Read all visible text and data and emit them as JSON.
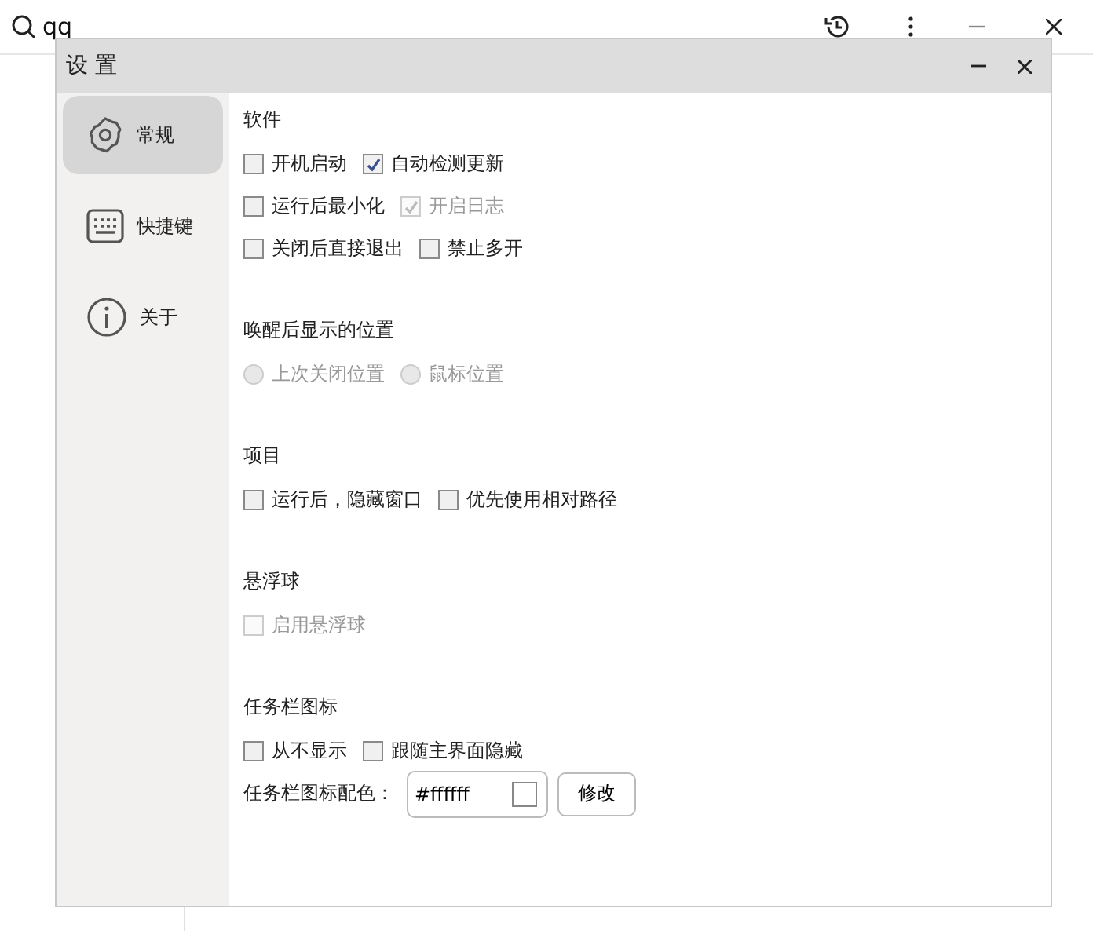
{
  "app_bar": {
    "search_value": "qq"
  },
  "window": {
    "title": "设 置"
  },
  "sidebar": {
    "items": [
      {
        "label": "常规",
        "selected": true
      },
      {
        "label": "快捷键",
        "selected": false
      },
      {
        "label": "关于",
        "selected": false
      }
    ]
  },
  "sections": [
    {
      "title": "软件",
      "rows": [
        [
          {
            "kind": "checkbox",
            "label": "开机启动",
            "checked": false,
            "disabled": false
          },
          {
            "kind": "checkbox",
            "label": "自动检测更新",
            "checked": true,
            "disabled": false
          }
        ],
        [
          {
            "kind": "checkbox",
            "label": "运行后最小化",
            "checked": false,
            "disabled": false
          },
          {
            "kind": "checkbox",
            "label": "开启日志",
            "checked": true,
            "disabled": true
          }
        ],
        [
          {
            "kind": "checkbox",
            "label": "关闭后直接退出",
            "checked": false,
            "disabled": false
          },
          {
            "kind": "checkbox",
            "label": "禁止多开",
            "checked": false,
            "disabled": false
          }
        ]
      ]
    },
    {
      "title": "唤醒后显示的位置",
      "rows": [
        [
          {
            "kind": "radio",
            "label": "上次关闭位置",
            "selected": false,
            "disabled": true
          },
          {
            "kind": "radio",
            "label": "鼠标位置",
            "selected": false,
            "disabled": true
          }
        ]
      ]
    },
    {
      "title": "项目",
      "rows": [
        [
          {
            "kind": "checkbox",
            "label": "运行后，隐藏窗口",
            "checked": false,
            "disabled": false
          },
          {
            "kind": "checkbox",
            "label": "优先使用相对路径",
            "checked": false,
            "disabled": false
          }
        ]
      ]
    },
    {
      "title": "悬浮球",
      "rows": [
        [
          {
            "kind": "checkbox",
            "label": "启用悬浮球",
            "checked": false,
            "disabled": true
          }
        ]
      ]
    },
    {
      "title": "任务栏图标",
      "rows": [
        [
          {
            "kind": "checkbox",
            "label": "从不显示",
            "checked": false,
            "disabled": false
          },
          {
            "kind": "checkbox",
            "label": "跟随主界面隐藏",
            "checked": false,
            "disabled": false
          }
        ],
        [
          {
            "kind": "color",
            "label": "任务栏图标配色：",
            "value": "#ffffff",
            "color": "#ffffff",
            "button": "修改"
          }
        ]
      ]
    }
  ]
}
